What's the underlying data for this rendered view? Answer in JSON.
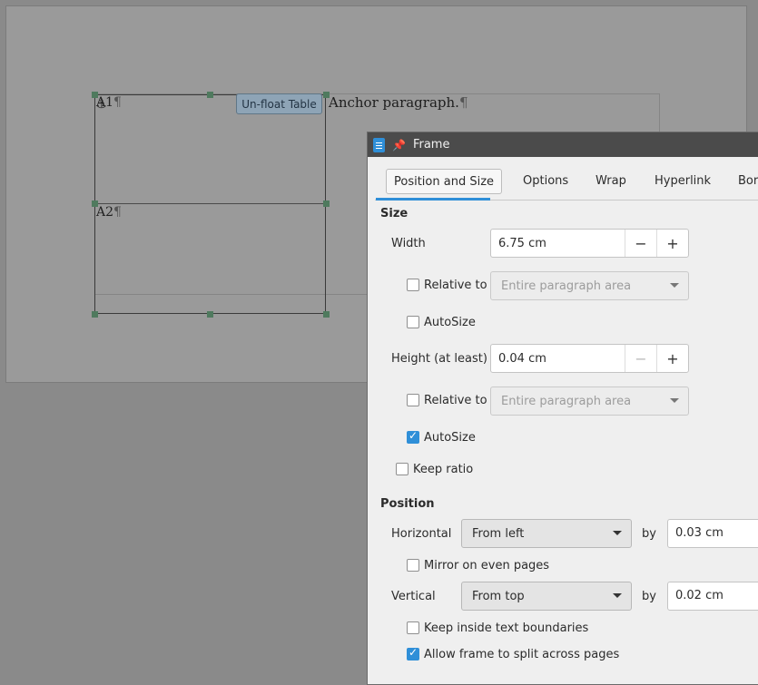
{
  "document": {
    "cell_a1": "A1",
    "cell_a2": "A2",
    "pilcrow": "¶",
    "anchor_paragraph": "Anchor paragraph.",
    "unfloat_button": "Un-float Table"
  },
  "dialog": {
    "title": "Frame",
    "tabs": [
      "Position and Size",
      "Options",
      "Wrap",
      "Hyperlink",
      "Bord"
    ],
    "active_tab": "Position and Size",
    "size": {
      "section": "Size",
      "width_label": "Width",
      "width_value": "6.75 cm",
      "width_relative_label": "Relative to",
      "width_relative_checked": false,
      "width_relative_select": "Entire paragraph area",
      "width_autosize_label": "AutoSize",
      "width_autosize_checked": false,
      "height_label": "Height (at least)",
      "height_value": "0.04 cm",
      "height_relative_label": "Relative to",
      "height_relative_checked": false,
      "height_relative_select": "Entire paragraph area",
      "height_autosize_label": "AutoSize",
      "height_autosize_checked": true,
      "keep_ratio_label": "Keep ratio",
      "keep_ratio_checked": false,
      "minus": "−",
      "plus": "+"
    },
    "position": {
      "section": "Position",
      "horizontal_label": "Horizontal",
      "horizontal_select": "From left",
      "by_label": "by",
      "horizontal_by": "0.03 cm",
      "mirror_label": "Mirror on even pages",
      "mirror_checked": false,
      "vertical_label": "Vertical",
      "vertical_select": "From top",
      "vertical_by": "0.02 cm",
      "keep_inside_label": "Keep inside text boundaries",
      "keep_inside_checked": false,
      "allow_split_label": "Allow frame to split across pages",
      "allow_split_checked": true
    }
  },
  "colors": {
    "accent": "#2f8fd8",
    "titlebar": "#4b4b4b",
    "dialog_bg": "#efefef"
  }
}
